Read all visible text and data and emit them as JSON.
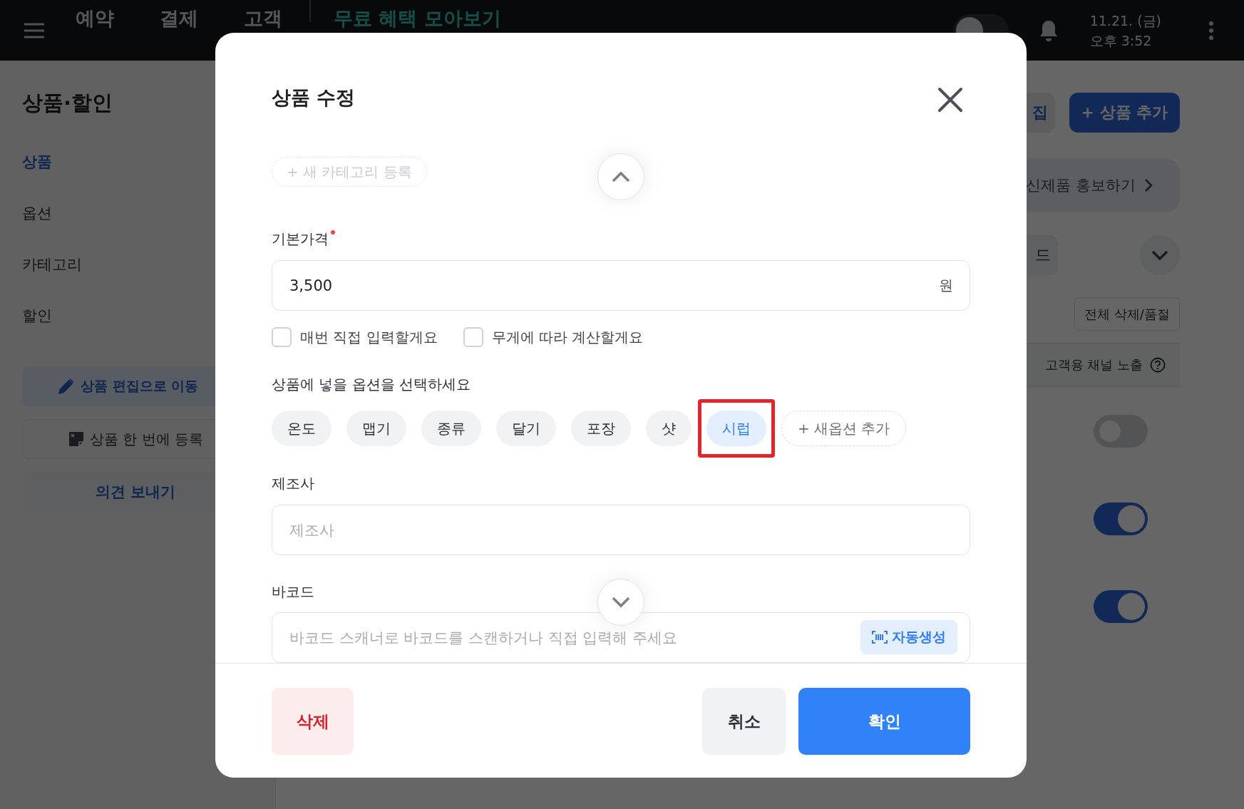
{
  "topbar": {
    "nav": [
      {
        "label": "예약"
      },
      {
        "label": "결제"
      },
      {
        "label": "고객"
      }
    ],
    "promo": "무료 혜택 모아보기",
    "dark_mode": {
      "on": false
    },
    "date": "11.21. (금)",
    "time": "오후 3:52"
  },
  "sidebar": {
    "title": "상품·할인",
    "items": [
      {
        "label": "상품",
        "selected": true
      },
      {
        "label": "옵션",
        "selected": false
      },
      {
        "label": "카테고리",
        "selected": false
      },
      {
        "label": "할인",
        "selected": false
      }
    ],
    "buttons": [
      {
        "kind": "edit",
        "label": "상품 편집으로 이동"
      },
      {
        "kind": "bulk",
        "label": "상품 한 번에 등록"
      },
      {
        "kind": "feedback",
        "label": "의견 보내기"
      }
    ]
  },
  "main": {
    "edit_button_fragment": "집",
    "add_button": "+ 상품 추가",
    "promo_banner": "신제품 홍보하기",
    "filter_fragment": "드",
    "bulk_button": "전체 삭제/품절",
    "column_header": "고객용 채널 노출",
    "toggles": [
      {
        "on": false
      },
      {
        "on": true
      },
      {
        "on": true
      }
    ]
  },
  "modal": {
    "title": "상품 수정",
    "new_category": "+ 새 카테고리 등록",
    "price_label": "기본가격",
    "price_required": true,
    "price_value": "3,500",
    "price_unit": "원",
    "checkboxes": [
      {
        "label": "매번 직접 입력할게요",
        "checked": false
      },
      {
        "label": "무게에 따라 계산할게요",
        "checked": false
      }
    ],
    "options_prompt": "상품에 넣을 옵션을 선택하세요",
    "options": [
      {
        "label": "온도",
        "selected": false,
        "highlighted": false
      },
      {
        "label": "맵기",
        "selected": false,
        "highlighted": false
      },
      {
        "label": "종류",
        "selected": false,
        "highlighted": false
      },
      {
        "label": "달기",
        "selected": false,
        "highlighted": false
      },
      {
        "label": "포장",
        "selected": false,
        "highlighted": false
      },
      {
        "label": "샷",
        "selected": false,
        "highlighted": false
      },
      {
        "label": "시럽",
        "selected": true,
        "highlighted": true
      }
    ],
    "add_option": "+ 새옵션 추가",
    "manufacturer_label": "제조사",
    "manufacturer_placeholder": "제조사",
    "barcode_label": "바코드",
    "barcode_placeholder": "바코드 스캐너로 바코드를 스캔하거나 직접 입력해 주세요",
    "auto_generate": "자동생성",
    "delete_button": "삭제",
    "cancel_button": "취소",
    "confirm_button": "확인"
  }
}
